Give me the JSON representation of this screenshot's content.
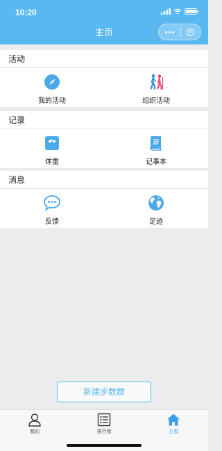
{
  "status_bar": {
    "time": "10:20"
  },
  "header": {
    "title": "主页"
  },
  "sections": [
    {
      "title": "活动",
      "items": [
        {
          "label": "我的活动",
          "icon": "compass-icon"
        },
        {
          "label": "组织活动",
          "icon": "hikers-icon"
        }
      ]
    },
    {
      "title": "记录",
      "items": [
        {
          "label": "体重",
          "icon": "scale-icon"
        },
        {
          "label": "记事本",
          "icon": "notebook-icon"
        }
      ]
    },
    {
      "title": "消息",
      "items": [
        {
          "label": "反馈",
          "icon": "chat-bubble-icon"
        },
        {
          "label": "足迹",
          "icon": "globe-icon"
        }
      ]
    }
  ],
  "create_button": {
    "label": "新建步数群"
  },
  "tabbar": {
    "tabs": [
      {
        "label": "我的",
        "icon": "person-icon"
      },
      {
        "label": "排行榜",
        "icon": "list-icon"
      },
      {
        "label": "主页",
        "icon": "home-icon",
        "active": true
      }
    ]
  },
  "colors": {
    "accent": "#5ab8f0",
    "tab_active": "#3aa0e8",
    "background": "#ececec"
  }
}
